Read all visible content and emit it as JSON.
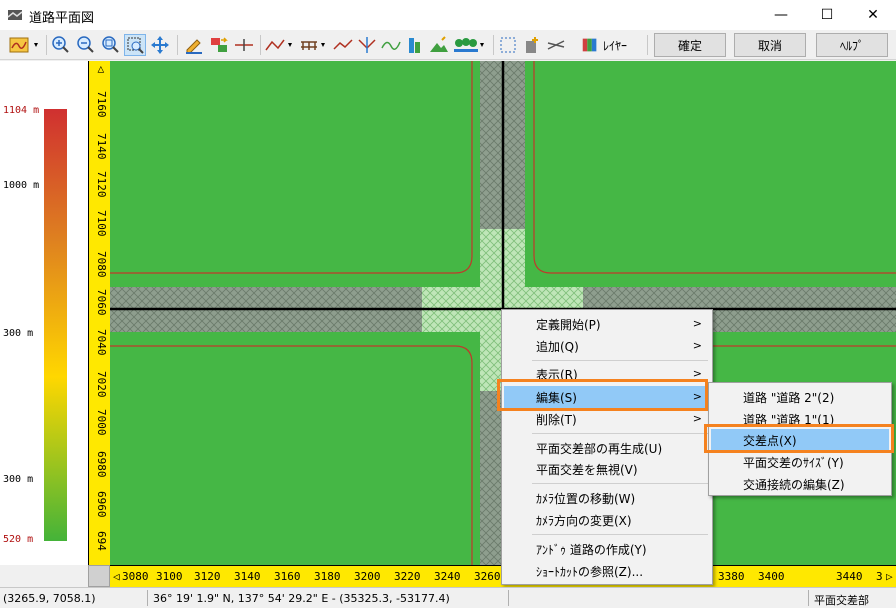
{
  "window": {
    "title": "道路平面図",
    "minimize_glyph": "—",
    "maximize_glyph": "☐",
    "close_glyph": "✕"
  },
  "toolbar": {
    "layer_label": "ﾚｲﾔｰ",
    "confirm_label": "確定",
    "cancel_label": "取消",
    "help_label": "ﾍﾙﾌﾟ",
    "icons": [
      "road-style-icon",
      "zoom-in-icon",
      "zoom-out-icon",
      "zoom-fit-icon",
      "zoom-window-icon",
      "pan-icon",
      "pencil-edit-icon",
      "convert-icon",
      "split-icon",
      "polyline-icon",
      "structure-icon",
      "line-icon",
      "intersect-icon",
      "curve-icon",
      "building-icon",
      "terrain-icon",
      "tree-icon",
      "select-rectangle-icon",
      "add-object-icon",
      "cut-icon",
      "layer-icon"
    ]
  },
  "legend": {
    "labels": [
      "1104 m",
      "1000 m",
      "300 m",
      "300 m",
      "520 m"
    ],
    "colors": {
      "top": "#d03030",
      "mid": "#ffd700",
      "bottom": "#44b339"
    }
  },
  "ruler": {
    "vertical": [
      "7160",
      "7140",
      "7120",
      "7100",
      "7080",
      "7060",
      "7040",
      "7020",
      "7000",
      "6980",
      "6960",
      "694"
    ],
    "horizontal": [
      "3080",
      "3100",
      "3120",
      "3140",
      "3160",
      "3180",
      "3200",
      "3220",
      "3240",
      "3260",
      "3380",
      "3400",
      "3440",
      "3"
    ],
    "left_arrow": "◁",
    "right_arrow": "▷"
  },
  "context_menu": {
    "items": [
      "定義開始(P)",
      "追加(Q)",
      "表示(R)",
      "編集(S)",
      "削除(T)",
      "平面交差部の再生成(U)",
      "平面交差を無視(V)",
      "ｶﾒﾗ位置の移動(W)",
      "ｶﾒﾗ方向の変更(X)",
      "ｱﾝﾄﾞｩ 道路の作成(Y)",
      "ｼｮｰﾄｶｯﾄの参照(Z)..."
    ],
    "arrow": ">",
    "highlighted": "編集(S)"
  },
  "submenu": {
    "items": [
      "道路 \"道路 2\"(2)",
      "道路 \"道路 1\"(1)",
      "交差点(X)",
      "平面交差のｻｲｽﾞ(Y)",
      "交通接続の編集(Z)"
    ],
    "highlighted": "交差点(X)"
  },
  "status": {
    "coords": "(3265.9, 7058.1)",
    "latlon": "36° 19' 1.9\" N, 137° 54' 29.2\" E  -  (35325.3, -53177.4)",
    "mode": "平面交差部"
  },
  "colors": {
    "map_green": "#45b745",
    "road": "#8c9a8c",
    "centerline": "#000000",
    "edge_line": "#c0392b",
    "highlight_orange": "#f5821f",
    "menu_highlight": "#91c9f7",
    "ruler_yellow": "#ffe800"
  }
}
